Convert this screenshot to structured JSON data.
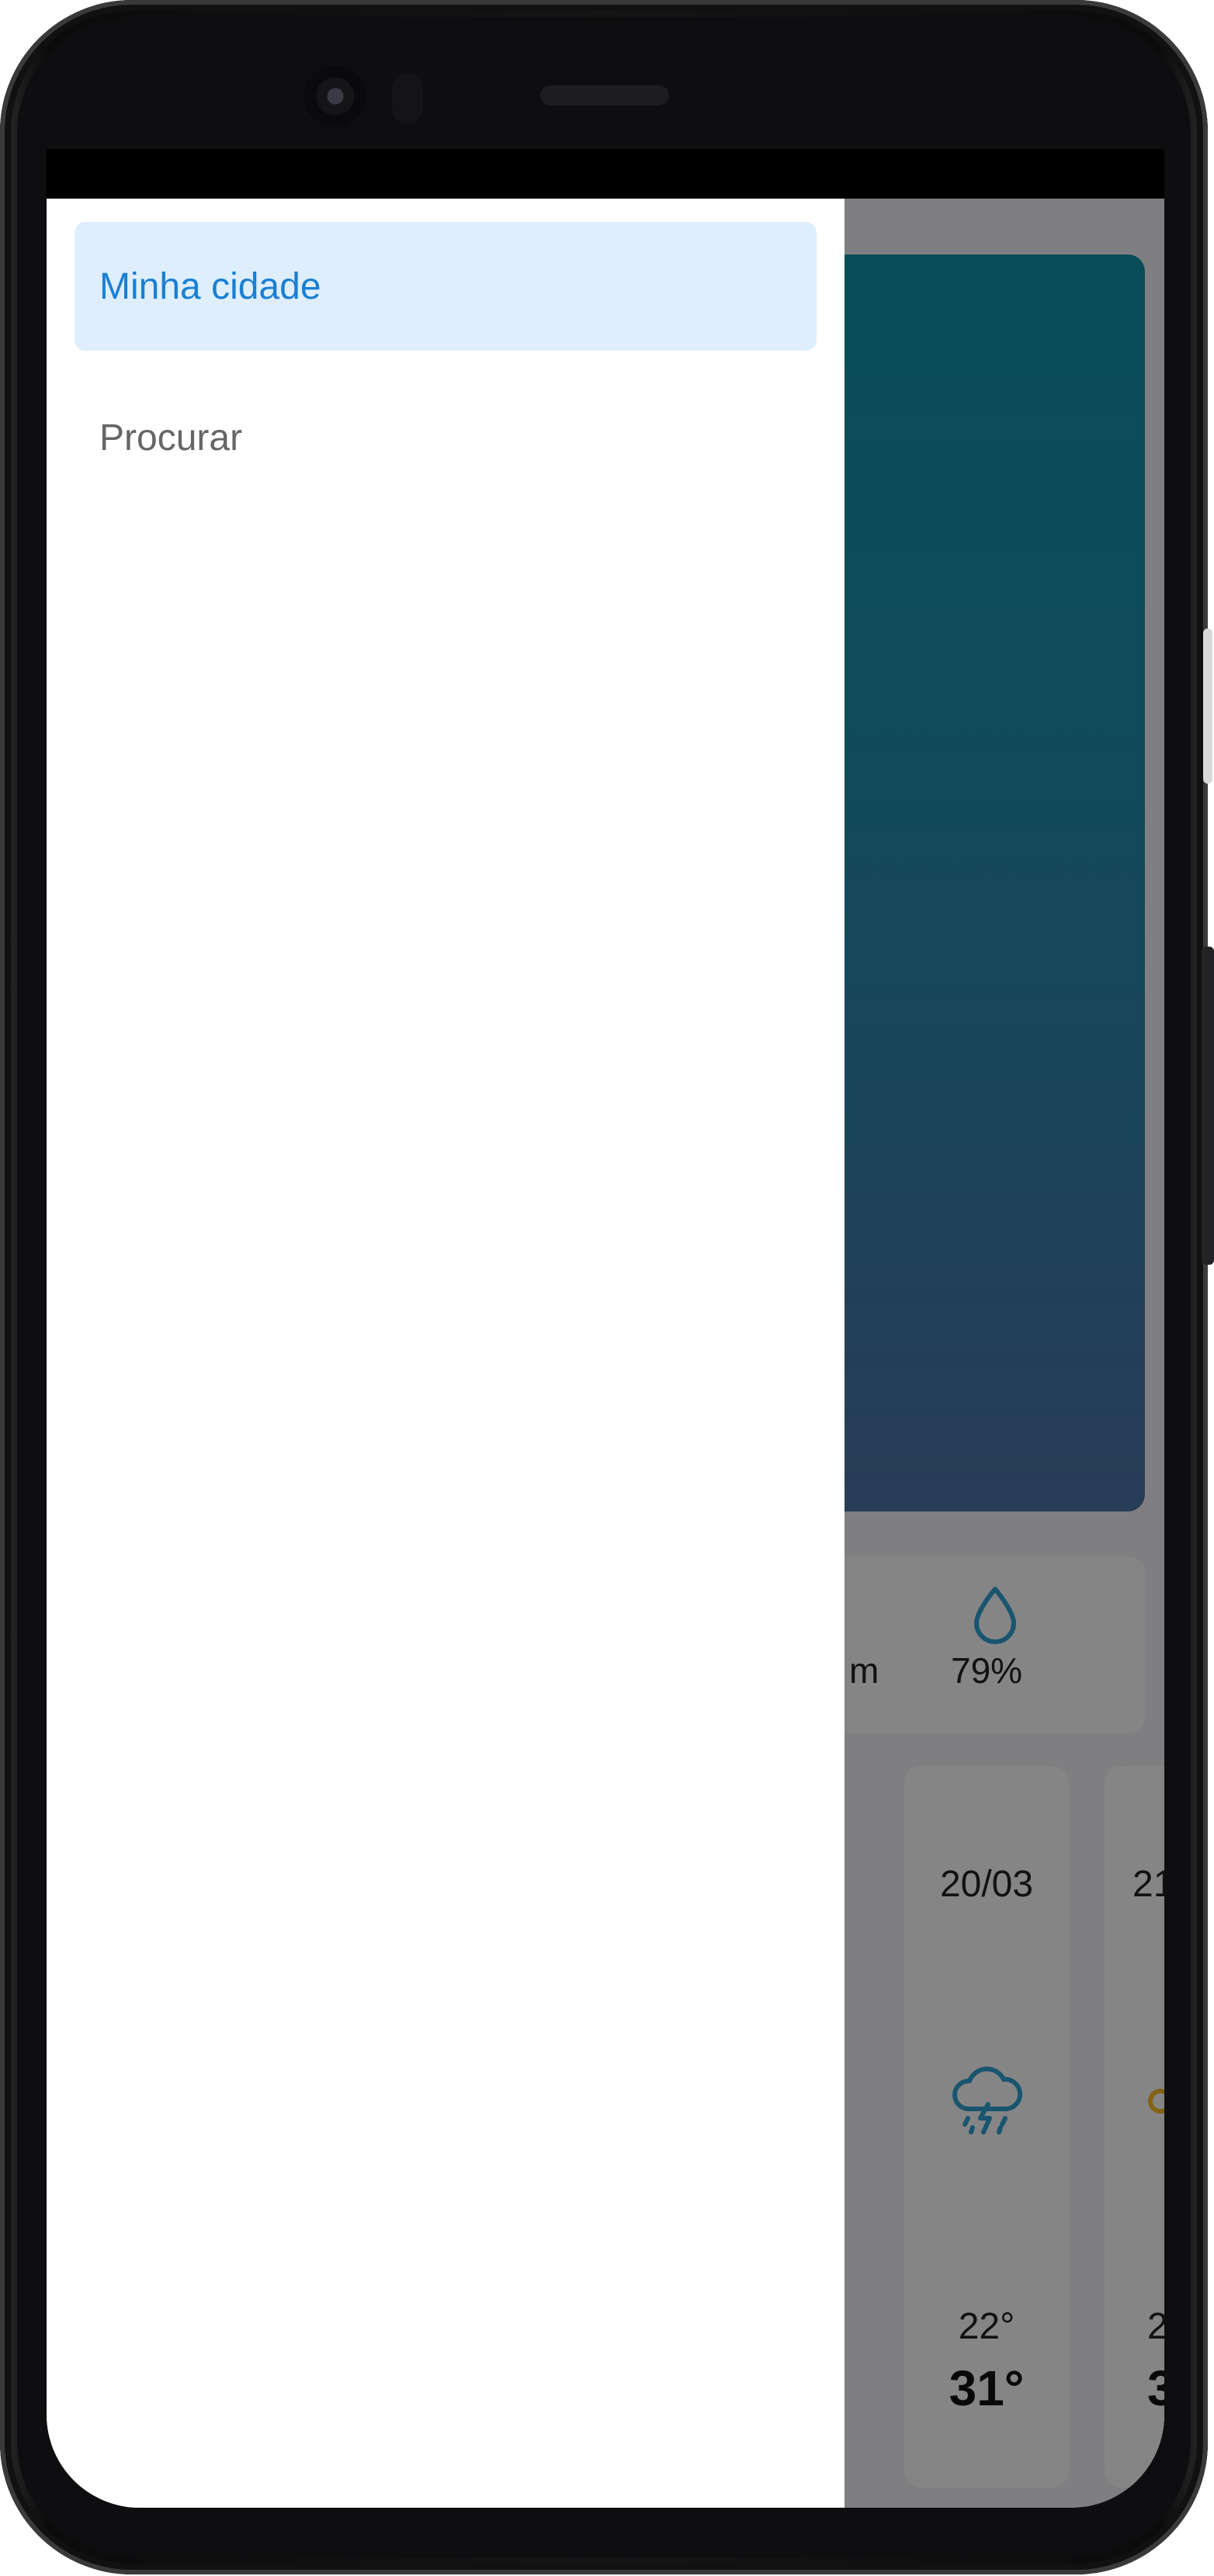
{
  "drawer": {
    "items": [
      {
        "label": "Minha cidade",
        "active": true
      },
      {
        "label": "Procurar",
        "active": false
      }
    ]
  },
  "background": {
    "stats": {
      "wind_partial": "m",
      "humidity": "79%",
      "humidity_icon": "water-drop-icon"
    },
    "forecast": [
      {
        "date": "20/03",
        "icon": "thunderstorm-icon",
        "min": "22°",
        "max": "31°"
      },
      {
        "date": "21",
        "icon": "sun-icon",
        "min": "2",
        "max": "3"
      }
    ]
  },
  "colors": {
    "accent": "#1a7fd3",
    "active_bg": "#deeefc",
    "hero_top": "#0f8d9f",
    "hero_bottom": "#4a6f9e",
    "icon_blue": "#2f9bc8",
    "sun": "#f0b323"
  }
}
